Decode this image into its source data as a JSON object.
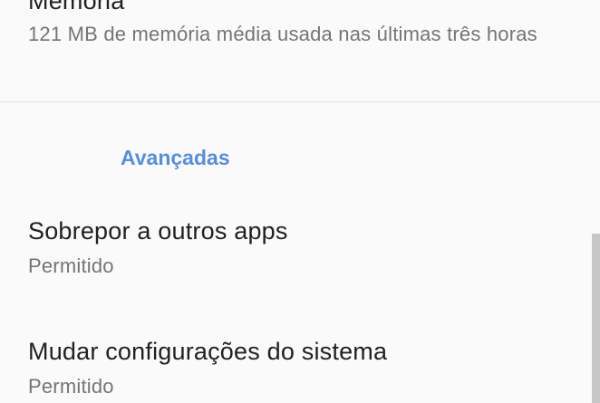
{
  "memory": {
    "title": "Memória",
    "summary": "121 MB de memória média usada nas últimas três horas"
  },
  "advanced_header": "Avançadas",
  "overlay": {
    "title": "Sobrepor a outros apps",
    "summary": "Permitido"
  },
  "system_settings": {
    "title": "Mudar configurações do sistema",
    "summary": "Permitido"
  }
}
